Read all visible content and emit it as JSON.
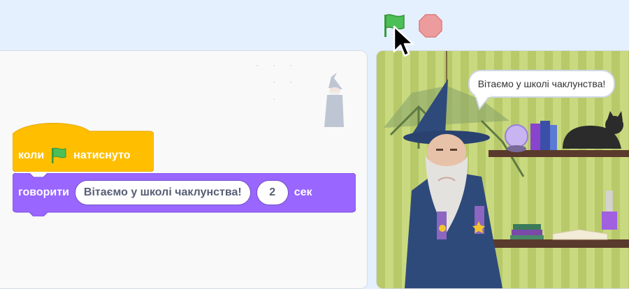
{
  "controls": {
    "green_flag": "green-flag-icon",
    "stop": "stop-icon"
  },
  "blocks": {
    "hat": {
      "before": "коли",
      "icon": "green-flag-icon",
      "after": "натиснуто",
      "color": "#ffbf00"
    },
    "say": {
      "label": "говорити",
      "message": "Вітаємо у школі чаклунства!",
      "seconds": "2",
      "unit": "сек",
      "color": "#9966ff"
    }
  },
  "stage": {
    "speech_bubble": "Вітаємо у школі чаклунства!"
  }
}
